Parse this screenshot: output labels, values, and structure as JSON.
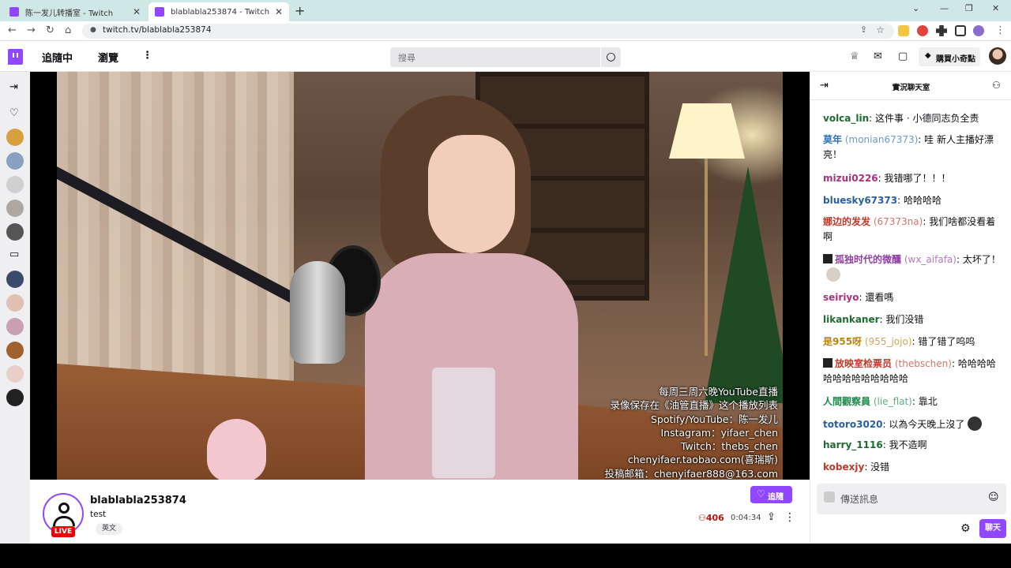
{
  "browser": {
    "tabs": [
      {
        "title": "陈一发儿转播室 - Twitch",
        "close": "✕"
      },
      {
        "title": "blablabla253874 - Twitch",
        "close": "✕"
      }
    ],
    "new_tab": "+",
    "url": "twitch.tv/blablabla253874",
    "back": "←",
    "forward": "→",
    "reload": "↻",
    "home": "⌂",
    "lock": "🔒",
    "bookmark": "☆",
    "menu": "⋮",
    "window_controls": [
      "⌄",
      "—",
      "❐",
      "✕"
    ]
  },
  "header": {
    "following": "追隨中",
    "browse": "瀏覽",
    "more": "⋮",
    "search_placeholder": "搜尋",
    "search_icon": "⚲",
    "bits_label": "購買小奇點",
    "icons": [
      "crown-icon",
      "mail-icon",
      "whisper-icon"
    ]
  },
  "sidebar": {
    "collapse": "⇥",
    "following_icon": "♡",
    "camera_icon": "▭"
  },
  "video": {
    "overlay_lines": [
      "每周三周六晚YouTube直播",
      "录像保存在《油管直播》这个播放列表",
      "Spotify/YouTube：陈一发儿",
      "Instagram：yifaer_chen",
      "Twitch：thebs_chen",
      "chenyifaer.taobao.com(喜瑞斯)",
      "投稿邮箱：chenyifaer888@163.com"
    ]
  },
  "stream": {
    "channel": "blablabla253874",
    "title": "test",
    "tag": "英文",
    "live": "LIVE",
    "follow": "追隨",
    "viewers": "406",
    "uptime": "0:04:34"
  },
  "chat": {
    "title": "實況聊天室",
    "placeholder": "傳送訊息",
    "send": "聊天",
    "messages": [
      {
        "user": "volca_lin",
        "alt": "",
        "text": "这件事 · 小德同志负全责",
        "color": "#1e6b2f"
      },
      {
        "user": "莫年",
        "alt": " (monian67373)",
        "text": "哇 新人主播好漂亮！",
        "color": "#2f6fb5"
      },
      {
        "user": "mizui0226",
        "alt": "",
        "text": "我错哪了！！！",
        "color": "#a8327a"
      },
      {
        "user": "bluesky67373",
        "alt": "",
        "text": "哈哈哈哈",
        "color": "#2a5fa0"
      },
      {
        "user": "娜边的发发",
        "alt": " (67373na)",
        "text": "我们啥都没看着啊",
        "color": "#c0392b"
      },
      {
        "user": "孤独时代的微醺",
        "alt": " (wx_aifafa)",
        "text": "太坏了！",
        "color": "#8e3fa0"
      },
      {
        "user": "seiriyo",
        "alt": "",
        "text": "還看嗎",
        "color": "#a8327a"
      },
      {
        "user": "likankaner",
        "alt": "",
        "text": "我们没错",
        "color": "#1e6b2f"
      },
      {
        "user": "是955呀",
        "alt": " (955_jojo)",
        "text": "错了错了呜呜",
        "color": "#b8860b"
      },
      {
        "user": "放映室检票员",
        "alt": " (thebschen)",
        "text": "哈哈哈哈哈哈哈哈哈哈哈哈哈",
        "color": "#c0392b"
      },
      {
        "user": "人間觀察員",
        "alt": " (lie_flat)",
        "text": "靠北",
        "color": "#1e8a4a"
      },
      {
        "user": "totoro3020",
        "alt": "",
        "text": "以為今天晚上沒了",
        "color": "#2a5fa0"
      },
      {
        "user": "harry_1116",
        "alt": "",
        "text": "我不造啊",
        "color": "#1e6b2f"
      },
      {
        "user": "kobexjy",
        "alt": "",
        "text": "没错",
        "color": "#c0392b"
      }
    ]
  },
  "colors": {
    "accent": "#9146ff",
    "live": "#eb0400"
  }
}
